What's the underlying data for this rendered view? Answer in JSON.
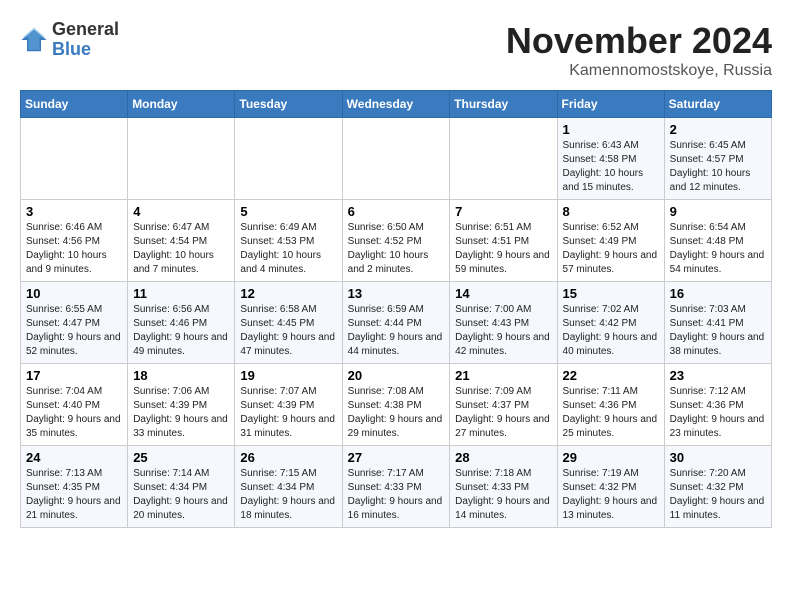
{
  "logo": {
    "general": "General",
    "blue": "Blue"
  },
  "title": "November 2024",
  "location": "Kamennomostskoye, Russia",
  "weekdays": [
    "Sunday",
    "Monday",
    "Tuesday",
    "Wednesday",
    "Thursday",
    "Friday",
    "Saturday"
  ],
  "weeks": [
    [
      {
        "day": "",
        "info": ""
      },
      {
        "day": "",
        "info": ""
      },
      {
        "day": "",
        "info": ""
      },
      {
        "day": "",
        "info": ""
      },
      {
        "day": "",
        "info": ""
      },
      {
        "day": "1",
        "info": "Sunrise: 6:43 AM\nSunset: 4:58 PM\nDaylight: 10 hours and 15 minutes."
      },
      {
        "day": "2",
        "info": "Sunrise: 6:45 AM\nSunset: 4:57 PM\nDaylight: 10 hours and 12 minutes."
      }
    ],
    [
      {
        "day": "3",
        "info": "Sunrise: 6:46 AM\nSunset: 4:56 PM\nDaylight: 10 hours and 9 minutes."
      },
      {
        "day": "4",
        "info": "Sunrise: 6:47 AM\nSunset: 4:54 PM\nDaylight: 10 hours and 7 minutes."
      },
      {
        "day": "5",
        "info": "Sunrise: 6:49 AM\nSunset: 4:53 PM\nDaylight: 10 hours and 4 minutes."
      },
      {
        "day": "6",
        "info": "Sunrise: 6:50 AM\nSunset: 4:52 PM\nDaylight: 10 hours and 2 minutes."
      },
      {
        "day": "7",
        "info": "Sunrise: 6:51 AM\nSunset: 4:51 PM\nDaylight: 9 hours and 59 minutes."
      },
      {
        "day": "8",
        "info": "Sunrise: 6:52 AM\nSunset: 4:49 PM\nDaylight: 9 hours and 57 minutes."
      },
      {
        "day": "9",
        "info": "Sunrise: 6:54 AM\nSunset: 4:48 PM\nDaylight: 9 hours and 54 minutes."
      }
    ],
    [
      {
        "day": "10",
        "info": "Sunrise: 6:55 AM\nSunset: 4:47 PM\nDaylight: 9 hours and 52 minutes."
      },
      {
        "day": "11",
        "info": "Sunrise: 6:56 AM\nSunset: 4:46 PM\nDaylight: 9 hours and 49 minutes."
      },
      {
        "day": "12",
        "info": "Sunrise: 6:58 AM\nSunset: 4:45 PM\nDaylight: 9 hours and 47 minutes."
      },
      {
        "day": "13",
        "info": "Sunrise: 6:59 AM\nSunset: 4:44 PM\nDaylight: 9 hours and 44 minutes."
      },
      {
        "day": "14",
        "info": "Sunrise: 7:00 AM\nSunset: 4:43 PM\nDaylight: 9 hours and 42 minutes."
      },
      {
        "day": "15",
        "info": "Sunrise: 7:02 AM\nSunset: 4:42 PM\nDaylight: 9 hours and 40 minutes."
      },
      {
        "day": "16",
        "info": "Sunrise: 7:03 AM\nSunset: 4:41 PM\nDaylight: 9 hours and 38 minutes."
      }
    ],
    [
      {
        "day": "17",
        "info": "Sunrise: 7:04 AM\nSunset: 4:40 PM\nDaylight: 9 hours and 35 minutes."
      },
      {
        "day": "18",
        "info": "Sunrise: 7:06 AM\nSunset: 4:39 PM\nDaylight: 9 hours and 33 minutes."
      },
      {
        "day": "19",
        "info": "Sunrise: 7:07 AM\nSunset: 4:39 PM\nDaylight: 9 hours and 31 minutes."
      },
      {
        "day": "20",
        "info": "Sunrise: 7:08 AM\nSunset: 4:38 PM\nDaylight: 9 hours and 29 minutes."
      },
      {
        "day": "21",
        "info": "Sunrise: 7:09 AM\nSunset: 4:37 PM\nDaylight: 9 hours and 27 minutes."
      },
      {
        "day": "22",
        "info": "Sunrise: 7:11 AM\nSunset: 4:36 PM\nDaylight: 9 hours and 25 minutes."
      },
      {
        "day": "23",
        "info": "Sunrise: 7:12 AM\nSunset: 4:36 PM\nDaylight: 9 hours and 23 minutes."
      }
    ],
    [
      {
        "day": "24",
        "info": "Sunrise: 7:13 AM\nSunset: 4:35 PM\nDaylight: 9 hours and 21 minutes."
      },
      {
        "day": "25",
        "info": "Sunrise: 7:14 AM\nSunset: 4:34 PM\nDaylight: 9 hours and 20 minutes."
      },
      {
        "day": "26",
        "info": "Sunrise: 7:15 AM\nSunset: 4:34 PM\nDaylight: 9 hours and 18 minutes."
      },
      {
        "day": "27",
        "info": "Sunrise: 7:17 AM\nSunset: 4:33 PM\nDaylight: 9 hours and 16 minutes."
      },
      {
        "day": "28",
        "info": "Sunrise: 7:18 AM\nSunset: 4:33 PM\nDaylight: 9 hours and 14 minutes."
      },
      {
        "day": "29",
        "info": "Sunrise: 7:19 AM\nSunset: 4:32 PM\nDaylight: 9 hours and 13 minutes."
      },
      {
        "day": "30",
        "info": "Sunrise: 7:20 AM\nSunset: 4:32 PM\nDaylight: 9 hours and 11 minutes."
      }
    ]
  ]
}
